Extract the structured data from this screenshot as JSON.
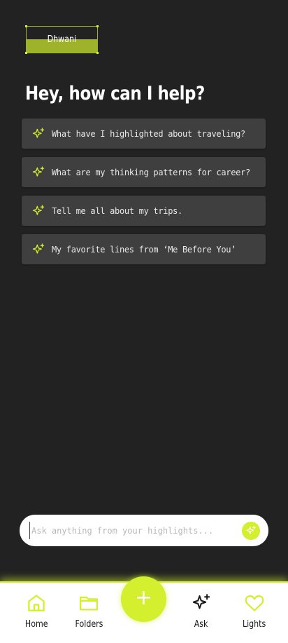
{
  "profile": {
    "name": "Dhwani"
  },
  "heading": "Hey, how can I help?",
  "suggestions": [
    {
      "text": "What have I highlighted about traveling?",
      "icon": "sparkle-icon"
    },
    {
      "text": "What are my thinking patterns for career?",
      "icon": "sparkle-icon"
    },
    {
      "text": "Tell me all about my trips.",
      "icon": "sparkle-icon"
    },
    {
      "text": "My favorite lines from ‘Me Before You’",
      "icon": "sparkle-icon"
    }
  ],
  "ask": {
    "placeholder": "Ask anything from your highlights...",
    "value": "",
    "send_icon": "sparkle-icon"
  },
  "nav": {
    "home_label": "Home",
    "folders_label": "Folders",
    "add_label": "+",
    "ask_label": "Ask",
    "lights_label": "Lights"
  },
  "colors": {
    "background": "#222222",
    "accent": "#d4ef2d",
    "card": "#3f3f3f",
    "nav_bg": "#ffffff"
  }
}
